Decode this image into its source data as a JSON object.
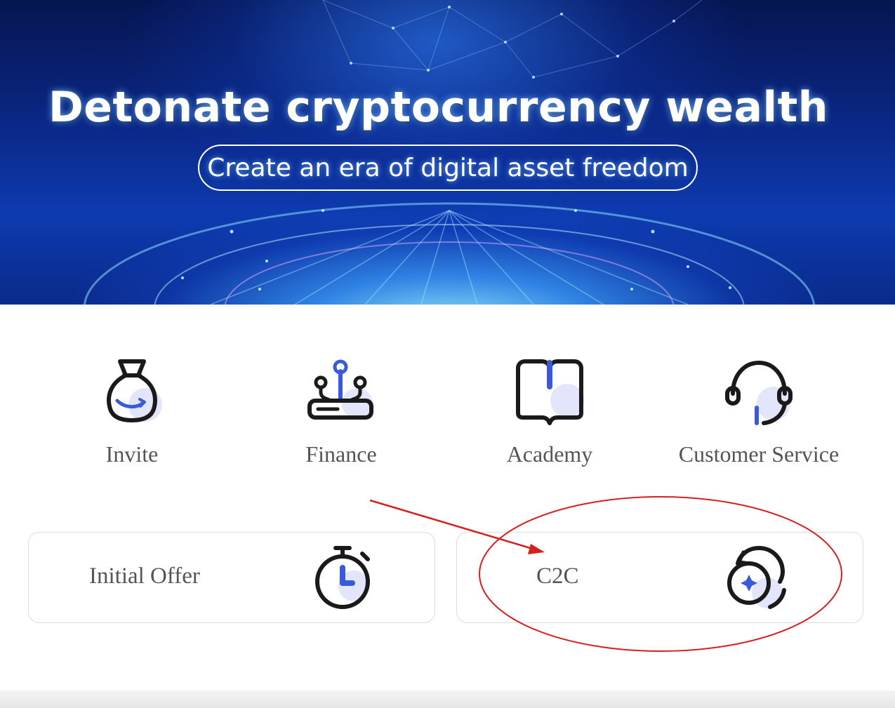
{
  "banner": {
    "title": "Detonate cryptocurrency wealth",
    "subtitle": "Create an era of digital asset freedom"
  },
  "shortcuts": [
    {
      "label": "Invite",
      "icon": "money-bag-icon"
    },
    {
      "label": "Finance",
      "icon": "finance-nodes-icon"
    },
    {
      "label": "Academy",
      "icon": "open-book-icon"
    },
    {
      "label": "Customer Service",
      "icon": "headset-icon"
    }
  ],
  "cards": [
    {
      "label": "Initial Offer",
      "icon": "stopwatch-icon"
    },
    {
      "label": "C2C",
      "icon": "coin-exchange-icon"
    }
  ],
  "colors": {
    "accent": "#3a5bd9",
    "icon_stroke": "#1a1a1a",
    "icon_fill_soft": "#e3e6fb",
    "text": "#555555",
    "annotation": "#d62020"
  }
}
